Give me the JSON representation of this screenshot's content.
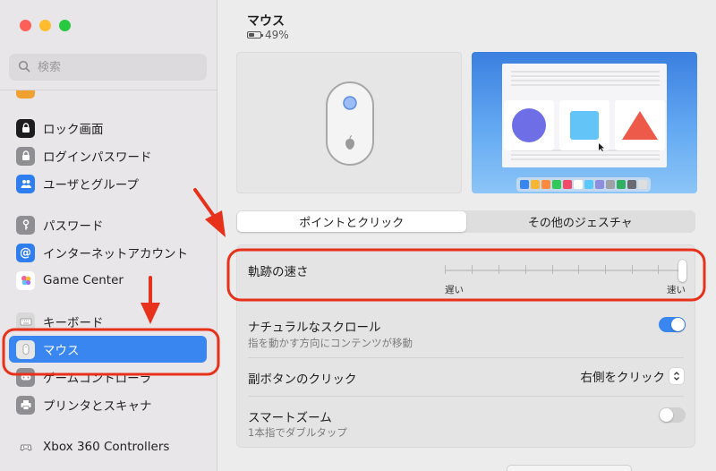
{
  "window": {
    "title": "マウス",
    "battery_level": "49%"
  },
  "search": {
    "placeholder": "検索"
  },
  "sidebar": {
    "items": [
      {
        "label": "ロック画面",
        "icon": "lock-icon"
      },
      {
        "label": "ログインパスワード",
        "icon": "lock-icon"
      },
      {
        "label": "ユーザとグループ",
        "icon": "users-icon"
      },
      {
        "label": "パスワード",
        "icon": "key-icon"
      },
      {
        "label": "インターネットアカウント",
        "icon": "at-icon"
      },
      {
        "label": "Game Center",
        "icon": "game-center-icon"
      },
      {
        "label": "キーボード",
        "icon": "keyboard-icon"
      },
      {
        "label": "マウス",
        "icon": "mouse-icon",
        "selected": true
      },
      {
        "label": "ゲームコントローラ",
        "icon": "gamepad-icon"
      },
      {
        "label": "プリンタとスキャナ",
        "icon": "printer-icon"
      },
      {
        "label": "Xbox 360 Controllers",
        "icon": "xbox-controller-icon"
      }
    ]
  },
  "tabs": [
    {
      "label": "ポイントとクリック",
      "active": true
    },
    {
      "label": "その他のジェスチャ",
      "active": false
    }
  ],
  "settings": {
    "tracking_speed": {
      "label": "軌跡の速さ",
      "min_label": "遅い",
      "max_label": "速い",
      "value_fraction": 1.0
    },
    "natural_scroll": {
      "label": "ナチュラルなスクロール",
      "description": "指を動かす方向にコンテンツが移動",
      "enabled": true
    },
    "secondary_click": {
      "label": "副ボタンのクリック",
      "value": "右側をクリック"
    },
    "smart_zoom": {
      "label": "スマートズーム",
      "description": "1本指でダブルタップ",
      "enabled": false
    }
  },
  "colors": {
    "accent": "#3a86f0",
    "annotation": "#e8311a"
  }
}
